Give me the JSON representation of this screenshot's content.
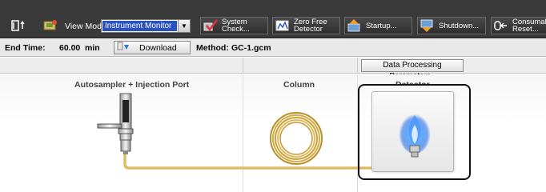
{
  "toolbar": {
    "view_mode_label": "View Mode:",
    "view_mode_value": "Instrument Monitor",
    "system_check_label": "System Check...",
    "zero_free_line1": "Zero Free",
    "zero_free_line2": "Detector",
    "startup_label": "Startup...",
    "shutdown_label": "Shutdown...",
    "consumable_line1": "Consumable",
    "consumable_line2": "Reset..."
  },
  "status_row": {
    "end_time_label": "End Time:",
    "end_time_value": "60.00",
    "end_time_unit": "min",
    "download_label": "Download",
    "method_label": "Method:",
    "method_value": "GC-1.gcm"
  },
  "params_row": {
    "data_processing_label": "Data Processing Parameters.."
  },
  "flow": {
    "autosampler_title": "Autosampler + Injection Port",
    "column_title": "Column",
    "detector_title": "Detector"
  },
  "colors": {
    "toolbar_bg": "#3a3a3a",
    "selection_blue": "#2a52be",
    "tubing_gold": "#c9a23a",
    "flame_blue": "#3a8cff"
  }
}
